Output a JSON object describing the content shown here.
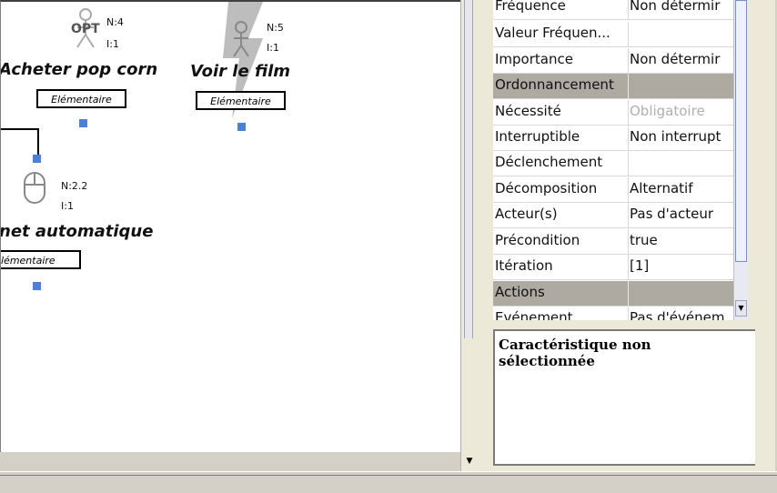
{
  "canvas": {
    "tasks": [
      {
        "name": "Acheter pop corn",
        "type": "Elémentaire",
        "badge": "OPT",
        "n": "N:4",
        "i": "I:1"
      },
      {
        "name": "Voir le film",
        "type": "Elémentaire",
        "n": "N:5",
        "i": "I:1"
      },
      {
        "name": "net automatique",
        "type": "lémentaire",
        "n": "N:2.2",
        "i": "I:1"
      }
    ]
  },
  "properties": {
    "rows": [
      {
        "key": "Fréquence",
        "value": "Non détermir",
        "kind": "normal"
      },
      {
        "key": "Valeur Fréquen...",
        "value": "",
        "kind": "normal"
      },
      {
        "key": "Importance",
        "value": "Non détermir",
        "kind": "normal"
      },
      {
        "key": "Ordonnancement",
        "value": "",
        "kind": "section"
      },
      {
        "key": "Nécessité",
        "value": "Obligatoire",
        "kind": "muted"
      },
      {
        "key": "Interruptible",
        "value": "Non interrupt",
        "kind": "normal"
      },
      {
        "key": "Déclenchement",
        "value": "",
        "kind": "normal"
      },
      {
        "key": "Décomposition",
        "value": "Alternatif",
        "kind": "normal"
      },
      {
        "key": "Acteur(s)",
        "value": "Pas d'acteur",
        "kind": "normal"
      },
      {
        "key": "Précondition",
        "value": "true",
        "kind": "normal"
      },
      {
        "key": "Itération",
        "value": "[1]",
        "kind": "normal"
      },
      {
        "key": "Actions",
        "value": "",
        "kind": "section"
      },
      {
        "key": "Evénement",
        "value": "Pas d'événem",
        "kind": "normal"
      }
    ]
  },
  "description": {
    "text": "Caractéristique non sélectionnée"
  },
  "colors": {
    "handle": "#4d7fd9",
    "section_row": "#aeaaa2"
  }
}
